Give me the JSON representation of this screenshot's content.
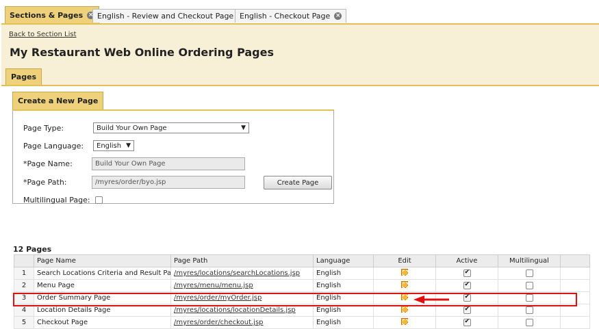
{
  "tabs": [
    {
      "label": "Sections & Pages",
      "active": true
    },
    {
      "label": "English - Review and Checkout Page",
      "active": false
    },
    {
      "label": "English - Checkout Page",
      "active": false
    }
  ],
  "back_link": "Back to Section List",
  "page_title": "My Restaurant Web Online Ordering Pages",
  "subtab": "Pages",
  "create_section": {
    "tab_label": "Create a New Page",
    "page_type_label": "Page Type:",
    "page_type_value": "Build Your Own Page",
    "language_label": "Page Language:",
    "language_value": "English",
    "name_label": "*Page Name:",
    "name_value": "Build Your Own Page",
    "path_label": "*Page Path:",
    "path_value": "/myres/order/byo.jsp",
    "create_button": "Create Page",
    "multilingual_label": "Multilingual Page:"
  },
  "pages_count": "12 Pages",
  "table": {
    "headers": [
      "",
      "Page Name",
      "Page Path",
      "Language",
      "Edit",
      "Active",
      "Multilingual"
    ],
    "rows": [
      {
        "num": "1",
        "name": "Search Locations Criteria and Result Pag",
        "path": "/myres/locations/searchLocations.jsp",
        "language": "English",
        "active": true,
        "multilingual": false
      },
      {
        "num": "2",
        "name": "Menu Page",
        "path": "/myres/menu/menu.jsp",
        "language": "English",
        "active": true,
        "multilingual": false
      },
      {
        "num": "3",
        "name": "Order Summary Page",
        "path": "/myres/order/myOrder.jsp",
        "language": "English",
        "active": true,
        "multilingual": false
      },
      {
        "num": "4",
        "name": "Location Details Page",
        "path": "/myres/locations/locationDetails.jsp",
        "language": "English",
        "active": true,
        "multilingual": false
      },
      {
        "num": "5",
        "name": "Checkout Page",
        "path": "/myres/order/checkout.jsp",
        "language": "English",
        "active": true,
        "multilingual": false
      }
    ]
  },
  "colors": {
    "accent": "#efd17b",
    "highlight": "#e01010"
  }
}
